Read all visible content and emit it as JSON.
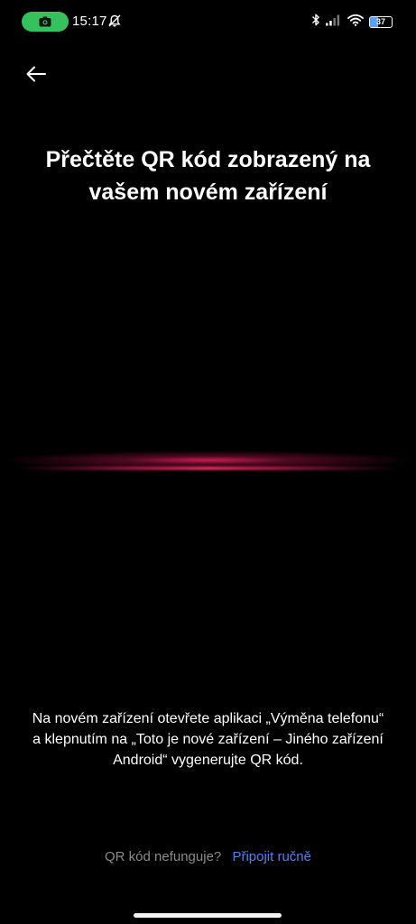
{
  "status_bar": {
    "time": "15:17",
    "battery_level": "37",
    "icons": [
      "screen-record-icon",
      "mute-icon",
      "bluetooth-icon",
      "signal-icon",
      "wifi-icon",
      "battery-icon"
    ]
  },
  "header": {
    "back_icon": "arrow-left-icon"
  },
  "main": {
    "title": "Přečtěte QR kód zobrazený na vašem novém zařízení",
    "instructions": "Na novém zařízení otevřete aplikaci „Výměna telefonu“ a klepnutím na „Toto je nové zařízení – Jiného zařízení Android“ vygenerujte QR kód."
  },
  "footer": {
    "question": "QR kód nefunguje?",
    "action": "Připojit ručně"
  },
  "colors": {
    "background": "#000000",
    "accent_link": "#4d82f7",
    "record_pill": "#35c25c",
    "scan_glow": "#d21e50"
  }
}
